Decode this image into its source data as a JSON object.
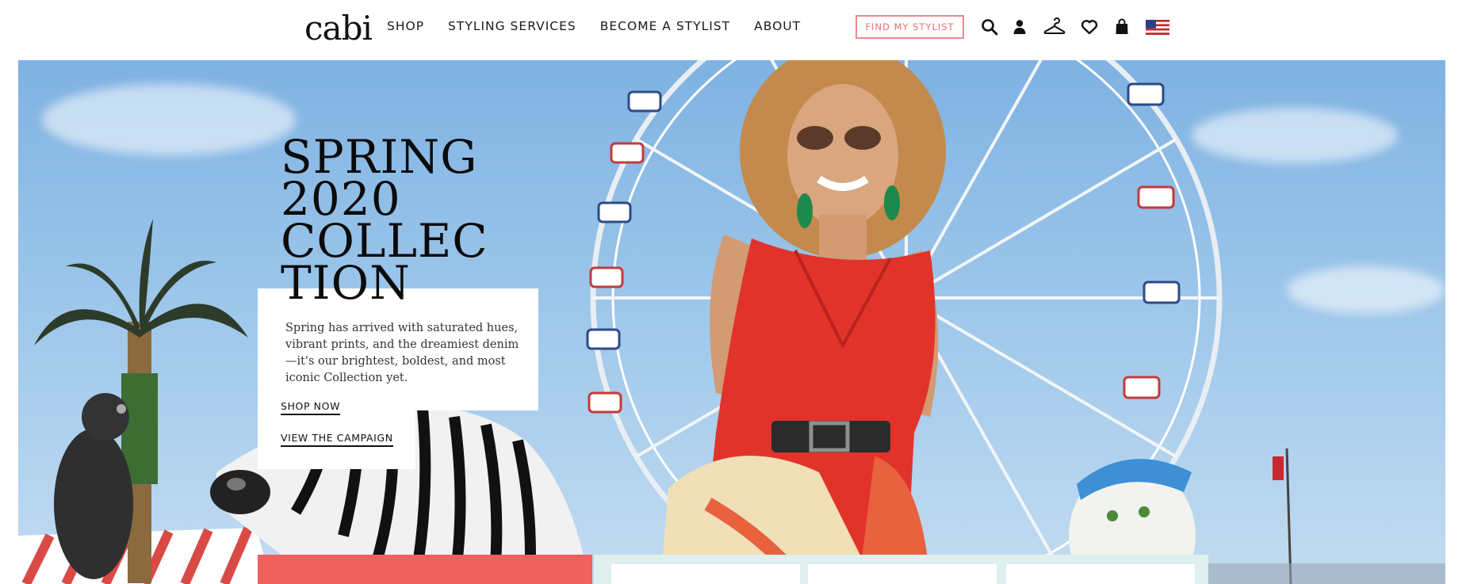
{
  "brand": {
    "logo_text": "cabi"
  },
  "nav": {
    "items": [
      "SHOP",
      "STYLING SERVICES",
      "BECOME A STYLIST",
      "ABOUT"
    ],
    "find_stylist": "FIND MY STYLIST"
  },
  "header_icons": [
    "search-icon",
    "account-icon",
    "hanger-icon",
    "heart-icon",
    "shopping-bag-icon",
    "us-flag-icon"
  ],
  "hero": {
    "headline_lines": [
      "SPRING",
      "2020",
      "COLLEC",
      "TION"
    ],
    "description": "Spring has arrived with saturated hues, vibrant prints, and the dreamiest denim—it's our brightest, boldest, and most iconic Collection yet.",
    "shop_now": "SHOP NOW",
    "view_campaign": "VIEW THE CAMPAIGN"
  },
  "colors": {
    "accent_pink": "#ee8a8e",
    "coral": "#f0605f",
    "dress_red": "#e2332b",
    "sky": "#9cc6ea"
  }
}
